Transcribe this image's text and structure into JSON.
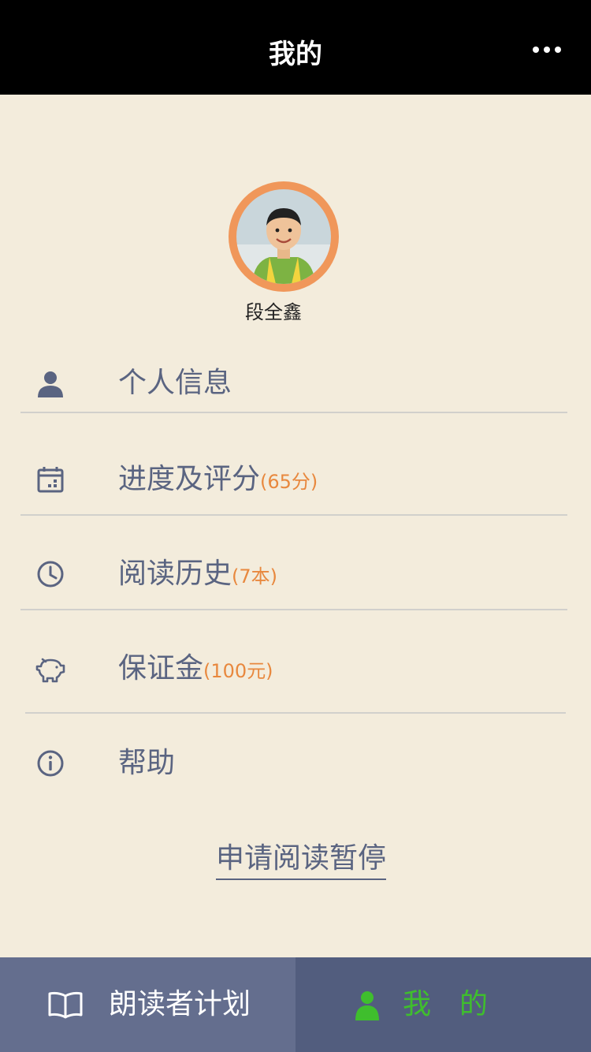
{
  "header": {
    "title": "我的",
    "more_icon": "more-dots-icon"
  },
  "profile": {
    "name": "段全鑫",
    "ring_color": "#f0975a"
  },
  "menu": {
    "items": [
      {
        "label": "个人信息",
        "badge": "",
        "icon": "person-icon"
      },
      {
        "label": "进度及评分",
        "badge": "(65分)",
        "icon": "calendar-icon"
      },
      {
        "label": "阅读历史",
        "badge": "(7本)",
        "icon": "clock-icon"
      },
      {
        "label": "保证金",
        "badge": "(100元)",
        "icon": "piggy-bank-icon"
      },
      {
        "label": "帮助",
        "badge": "",
        "icon": "info-icon"
      }
    ]
  },
  "pause_link": "申请阅读暂停",
  "tab_bar": {
    "tabs": [
      {
        "label": "朗读者计划",
        "icon": "open-book-icon",
        "active": false
      },
      {
        "label": "我　的",
        "icon": "person-icon",
        "active": true
      }
    ],
    "active_color": "#3fbe2d",
    "inactive_color": "#ffffff"
  },
  "colors": {
    "background": "#f3ecdc",
    "text": "#5a6481",
    "badge": "#e8883e"
  }
}
